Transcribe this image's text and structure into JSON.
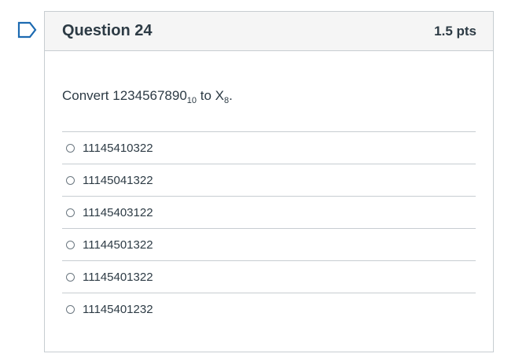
{
  "question": {
    "title": "Question 24",
    "points": "1.5 pts",
    "text_prefix": "Convert 1234567890",
    "text_sub1": "10",
    "text_mid": " to X",
    "text_sub2": "8",
    "text_suffix": ".",
    "answers": [
      {
        "label": "11145410322"
      },
      {
        "label": "11145041322"
      },
      {
        "label": "11145403122"
      },
      {
        "label": "11144501322"
      },
      {
        "label": "11145401322"
      },
      {
        "label": "11145401232"
      }
    ]
  },
  "flag_icon": "bookmark-flag-icon",
  "colors": {
    "flag": "#1c6ab1",
    "border": "#c7cdd1",
    "header_bg": "#f5f5f5",
    "text": "#2d3b45"
  }
}
